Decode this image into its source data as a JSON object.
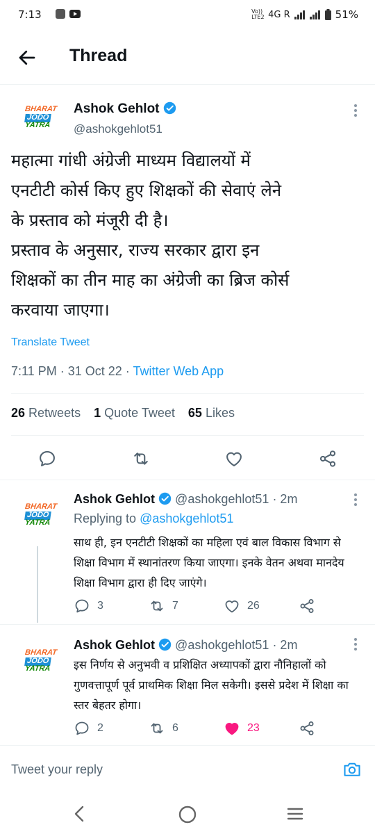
{
  "status_bar": {
    "time": "7:13",
    "network": "4G R",
    "volte": "Vo)) LTE2",
    "battery": "51%"
  },
  "header": {
    "title": "Thread"
  },
  "avatar": {
    "line1": "BHARAT",
    "line2": "JODO",
    "line3": "YATRA"
  },
  "main_tweet": {
    "author_name": "Ashok Gehlot",
    "author_handle": "@ashokgehlot51",
    "text": "महात्मा गांधी अंग्रेजी माध्यम विद्यालयों में\nएनटीटी कोर्स किए हुए शिक्षकों की सेवाएं लेने\nके प्रस्ताव को मंजूरी दी है।\nप्रस्ताव के अनुसार, राज्य सरकार द्वारा इन\nशिक्षकों का तीन माह का अंग्रेजी का ब्रिज कोर्स\nकरवाया जाएगा।",
    "translate_label": "Translate Tweet",
    "time": "7:11 PM",
    "date": "31 Oct 22",
    "source": "Twitter Web App",
    "retweets_count": "26",
    "retweets_label": "Retweets",
    "quotes_count": "1",
    "quotes_label": "Quote Tweet",
    "likes_count": "65",
    "likes_label": "Likes"
  },
  "replies": [
    {
      "author_name": "Ashok Gehlot",
      "author_handle": "@ashokgehlot51",
      "age": "· 2m",
      "replying_prefix": "Replying to",
      "replying_to": "@ashokgehlot51",
      "text": "साथ ही, इन एनटीटी शिक्षकों का महिला एवं बाल विकास विभाग से शिक्षा विभाग में स्थानांतरण किया जाएगा। इनके वेतन अथवा मानदेय शिक्षा विभाग द्वारा ही दिए जाएंगे।",
      "replies_count": "3",
      "retweets_count": "7",
      "likes_count": "26"
    },
    {
      "author_name": "Ashok Gehlot",
      "author_handle": "@ashokgehlot51",
      "age": "· 2m",
      "text": "इस निर्णय से अनुभवी व प्रशिक्षित अध्यापकों द्वारा नौनिहालों को गुणवत्तापूर्ण पूर्व प्राथमिक शिक्षा मिल सकेगी। इससे प्रदेश में शिक्षा का स्तर बेहतर होगा।",
      "replies_count": "2",
      "retweets_count": "6",
      "likes_count": "23",
      "liked": true
    }
  ],
  "reply_bar": {
    "placeholder": "Tweet your reply"
  },
  "colors": {
    "accent": "#1d9bf0",
    "like": "#f91880",
    "muted": "#536471"
  }
}
